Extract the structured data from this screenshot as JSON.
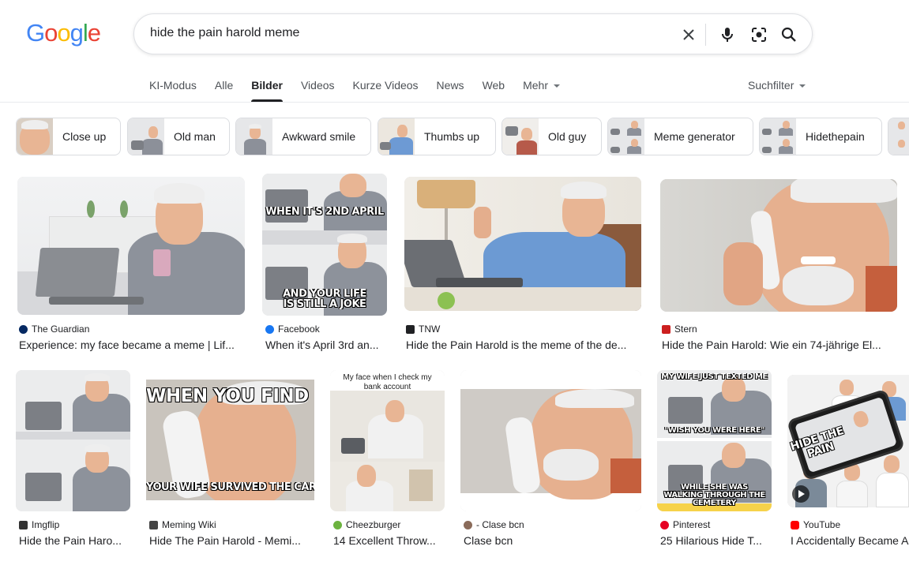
{
  "logo": {
    "letters": [
      "G",
      "o",
      "o",
      "g",
      "l",
      "e"
    ],
    "colors": [
      "#4285f4",
      "#ea4335",
      "#fbbc05",
      "#4285f4",
      "#34a853",
      "#ea4335"
    ]
  },
  "search": {
    "query": "hide the pain harold meme"
  },
  "icons": {
    "clear": "close-icon",
    "voice": "microphone-icon",
    "lens": "camera-lens-icon",
    "search": "search-icon"
  },
  "tabs": [
    {
      "label": "KI-Modus"
    },
    {
      "label": "Alle"
    },
    {
      "label": "Bilder",
      "active": true
    },
    {
      "label": "Videos"
    },
    {
      "label": "Kurze Videos"
    },
    {
      "label": "News"
    },
    {
      "label": "Web"
    },
    {
      "label": "Mehr"
    }
  ],
  "filter": {
    "label": "Suchfilter"
  },
  "chips": [
    {
      "label": "Close up"
    },
    {
      "label": "Old man"
    },
    {
      "label": "Awkward smile"
    },
    {
      "label": "Thumbs up"
    },
    {
      "label": "Old guy"
    },
    {
      "label": "Meme generator"
    },
    {
      "label": "Hidethepain"
    }
  ],
  "results": [
    {
      "source": "The Guardian",
      "title": "Experience: my face became a meme | Lif...",
      "favicon_color": "#052962"
    },
    {
      "source": "Facebook",
      "title": "When it's April 3rd an...",
      "favicon_color": "#1877f2",
      "meme_top": "WHEN IT'S 2ND APRIL",
      "meme_bottom": "AND YOUR LIFE IS STILL A JOKE"
    },
    {
      "source": "TNW",
      "title": "Hide the Pain Harold is the meme of the de...",
      "favicon_color": "#202124"
    },
    {
      "source": "Stern",
      "title": "Hide the Pain Harold: Wie ein 74-jährige El...",
      "favicon_color": "#cc1f1f"
    },
    {
      "source": "Imgflip",
      "title": "Hide the Pain Haro...",
      "favicon_color": "#333333"
    },
    {
      "source": "Meming Wiki",
      "title": "Hide The Pain Harold - Memi...",
      "favicon_color": "#444444",
      "meme_top": "WHEN YOU FIND OUT",
      "meme_bottom": "YOUR WIFE SURVIVED THE CAR CRASH"
    },
    {
      "source": "Cheezburger",
      "title": "14 Excellent Throw...",
      "favicon_color": "#6cb33f",
      "meme_top": "My face when I check my bank account"
    },
    {
      "source": "- Clase bcn",
      "title": "Clase bcn",
      "favicon_color": "#8a6b5a"
    },
    {
      "source": "Pinterest",
      "title": "25 Hilarious Hide T...",
      "favicon_color": "#e60023",
      "meme_top": "MY WIFE JUST TEXTED ME",
      "meme_mid": "\"WISH YOU WERE HERE\"",
      "meme_bottom": "WHILE SHE WAS WALKING THROUGH THE CEMETERY"
    },
    {
      "source": "YouTube",
      "title": "I Accidentally Became A",
      "favicon_color": "#ff0000",
      "meme_top": "HIDE THE PAIN"
    }
  ]
}
